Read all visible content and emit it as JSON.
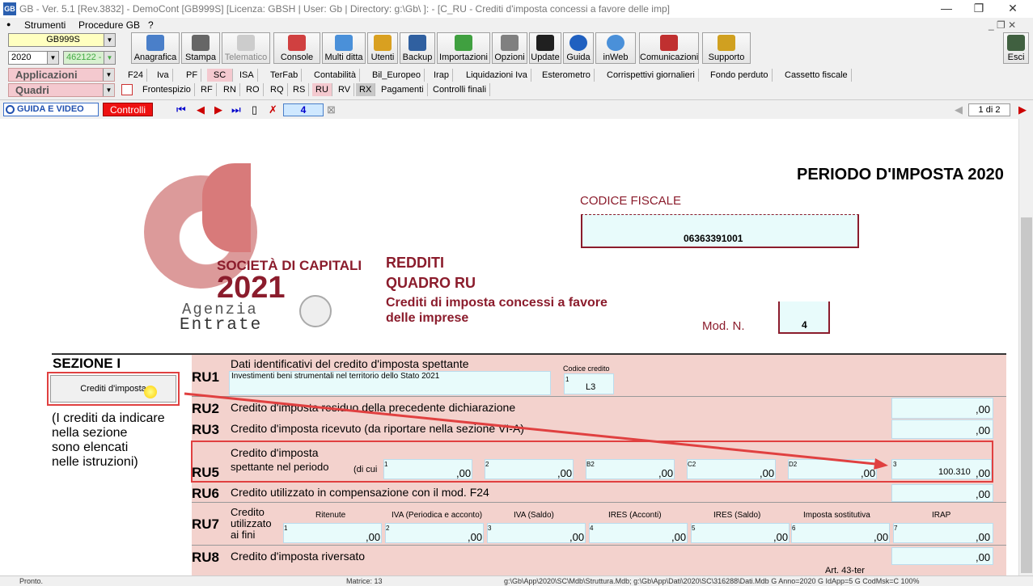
{
  "window": {
    "title": "GB - Ver. 5.1 [Rev.3832] -    DemoCont [GB999S]       [Licenza: GBSH | User: Gb | Directory: g:\\Gb\\ ]: - [C_RU - Crediti d'imposta concessi a favore delle imp]",
    "minimize": "—",
    "restore": "❐",
    "close": "✕"
  },
  "menu": {
    "items": [
      "Strumenti",
      "Procedure GB",
      "?"
    ],
    "mdi": "_ ❐ ✕"
  },
  "toolbar": {
    "company_combo": "GB999S",
    "year_combo": "2020",
    "code_combo": "462122 -",
    "buttons": [
      {
        "label": "Anagrafica",
        "color": "#4a7fc9"
      },
      {
        "label": "Stampa",
        "color": "#666666"
      },
      {
        "label": "Telematico",
        "color": "#aaaaaa"
      },
      {
        "label": "Console",
        "color": "#d04040"
      },
      {
        "label": "Multi ditta",
        "color": "#4a90d9"
      },
      {
        "label": "Utenti",
        "color": "#d9a020"
      },
      {
        "label": "Backup",
        "color": "#3060a0"
      },
      {
        "label": "Importazioni",
        "color": "#40a040"
      },
      {
        "label": "Opzioni",
        "color": "#808080"
      },
      {
        "label": "Update",
        "color": "#202020"
      },
      {
        "label": "Guida",
        "color": "#2060c0"
      },
      {
        "label": "inWeb",
        "color": "#4a90d9"
      },
      {
        "label": "Comunicazioni",
        "color": "#c03030"
      },
      {
        "label": "Supporto",
        "color": "#d0a020"
      }
    ],
    "exit_label": "Esci"
  },
  "tabs_row1": {
    "selector": "Applicazioni",
    "items": [
      "F24",
      "Iva",
      "PF",
      "SC",
      "ISA",
      "TerFab",
      "Contabilità",
      "Bil_Europeo",
      "Irap",
      "Liquidazioni Iva",
      "Esterometro",
      "Corrispettivi giornalieri",
      "Fondo perduto",
      "Cassetto fiscale"
    ],
    "active": "SC"
  },
  "tabs_row2": {
    "selector": "Quadri",
    "items": [
      "Frontespizio",
      "RF",
      "RN",
      "RO",
      "RQ",
      "RS",
      "RU",
      "RV",
      "RX",
      "Pagamenti",
      "Controlli finali"
    ],
    "active": "RU"
  },
  "navbar": {
    "guida_label": "GUIDA E VIDEO",
    "controlli_label": "Controlli",
    "module_number": "4",
    "page_indicator": "1 di 2"
  },
  "form": {
    "periodo": "PERIODO D'IMPOSTA 2020",
    "codice_fiscale_label": "CODICE FISCALE",
    "codice_fiscale": "06363391001",
    "logo_text": "SOCIETÀ DI CAPITALI",
    "logo_year": "2021",
    "agenzia": "Agenzia",
    "entrate": "Entrate",
    "redditi": "REDDITI",
    "quadro": "QUADRO RU",
    "quadro_desc_1": "Crediti di imposta concessi a favore",
    "quadro_desc_2": "delle imprese",
    "mod_label": "Mod. N.",
    "mod_value": "4",
    "sezione": "SEZIONE I",
    "crediti_button": "Crediti d'imposta",
    "note_1": "(I crediti da indicare",
    "note_2": "nella sezione",
    "note_3": "sono elencati",
    "note_4": "nelle istruzioni)",
    "ru1_label": "RU1",
    "ru1_text": "Dati identificativi del credito d'imposta spettante",
    "ru1_value": "Investimenti beni strumentali nel territorio dello Stato 2021",
    "codice_credito_label": "Codice credito",
    "codice_credito": "L3",
    "ru2_label": "RU2",
    "ru2_text": "Credito d'imposta residuo della precedente dichiarazione",
    "ru3_label": "RU3",
    "ru3_text": "Credito d'imposta ricevuto (da riportare nella sezione VI-A)",
    "ru5_label": "RU5",
    "ru5_text_1": "Credito d'imposta",
    "ru5_text_2": "spettante nel periodo",
    "ru5_dicui": "(di cui",
    "ru5_value": "100.310",
    "ru6_label": "RU6",
    "ru6_text": "Credito utilizzato in compensazione con il mod. F24",
    "ru7_label": "RU7",
    "ru7_text_1": "Credito",
    "ru7_text_2": "utilizzato",
    "ru7_text_3": "ai fini",
    "ru7_cols": [
      "Ritenute",
      "IVA (Periodica e acconto)",
      "IVA (Saldo)",
      "IRES (Acconti)",
      "IRES (Saldo)",
      "Imposta sostitutiva",
      "IRAP"
    ],
    "ru8_label": "RU8",
    "ru8_text": "Credito d'imposta riversato",
    "ru9_art": "Art. 43-ter",
    "zero": ",00",
    "field_nums": {
      "n1": "1",
      "n2": "2",
      "n3": "3",
      "b2": "B2",
      "c2": "C2",
      "d2": "D2",
      "n4": "4",
      "n5": "5",
      "n6": "6",
      "n7": "7"
    }
  },
  "status": {
    "left": "Pronto.",
    "matrice": "Matrice: 13",
    "path": "g:\\Gb\\App\\2020\\SC\\Mdb\\Struttura.Mdb; g:\\Gb\\App\\Dati\\2020\\SC\\316288\\Dati.Mdb G  Anno=2020 G  IdApp=5 G  CodMsk=C    100%"
  },
  "colors": {
    "accent_pink": "#f4c9cf",
    "maroon": "#8b1c2c",
    "field_cyan": "#e8fbfb",
    "highlight_red": "#e04040"
  }
}
